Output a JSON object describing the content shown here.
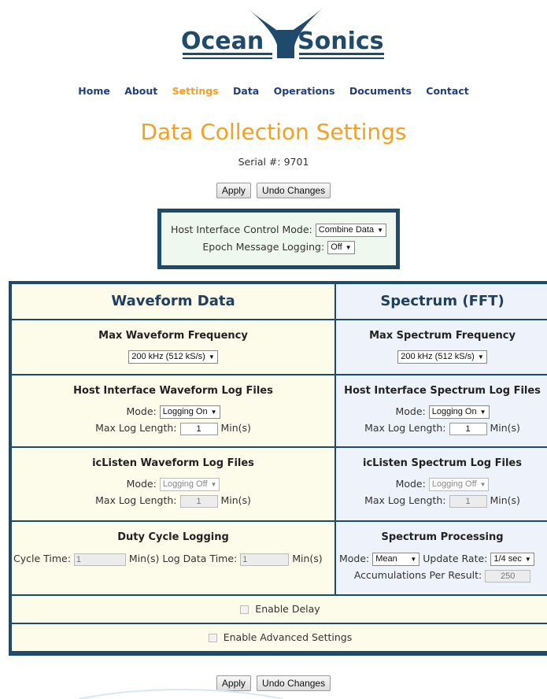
{
  "brand": {
    "name_left": "Ocean",
    "name_right": "Sonics",
    "color": "#1f4a6b"
  },
  "nav": [
    "Home",
    "About",
    "Settings",
    "Data",
    "Operations",
    "Documents",
    "Contact"
  ],
  "nav_active": "Settings",
  "page": {
    "title": "Data Collection Settings",
    "serial": "Serial #: 9701"
  },
  "buttons": {
    "apply": "Apply",
    "undo": "Undo Changes"
  },
  "host": {
    "control_mode_label": "Host Interface Control Mode:",
    "control_mode_value": "Combine Data",
    "epoch_label": "Epoch Message Logging:",
    "epoch_value": "Off"
  },
  "waveform": {
    "title": "Waveform Data",
    "max_freq_title": "Max Waveform Frequency",
    "max_freq_value": "200 kHz (512 kS/s)",
    "host_log_title": "Host Interface Waveform Log Files",
    "mode_label": "Mode:",
    "host_mode_value": "Logging On",
    "max_log_label": "Max Log Length:",
    "host_max_log_value": "1",
    "min_unit": "Min(s)",
    "iclisten_title": "icListen Waveform Log Files",
    "iclisten_mode_value": "Logging Off",
    "iclisten_max_log_value": "1",
    "duty_title": "Duty Cycle Logging",
    "cycle_time_label": "Cycle Time:",
    "cycle_time_value": "1",
    "log_data_time_label": "Min(s) Log Data Time:",
    "log_data_time_value": "1"
  },
  "spectrum": {
    "title": "Spectrum (FFT)",
    "max_freq_title": "Max Spectrum Frequency",
    "max_freq_value": "200 kHz (512 kS/s)",
    "host_log_title": "Host Interface Spectrum Log Files",
    "host_mode_value": "Logging On",
    "host_max_log_value": "1",
    "iclisten_title": "icListen Spectrum Log Files",
    "iclisten_mode_value": "Logging Off",
    "iclisten_max_log_value": "1",
    "processing_title": "Spectrum Processing",
    "proc_mode_value": "Mean",
    "update_rate_label": "Update Rate:",
    "update_rate_value": "1/4 sec",
    "accum_label": "Accumulations Per Result:",
    "accum_value": "250"
  },
  "options": {
    "enable_delay": "Enable Delay",
    "enable_advanced": "Enable Advanced Settings"
  }
}
